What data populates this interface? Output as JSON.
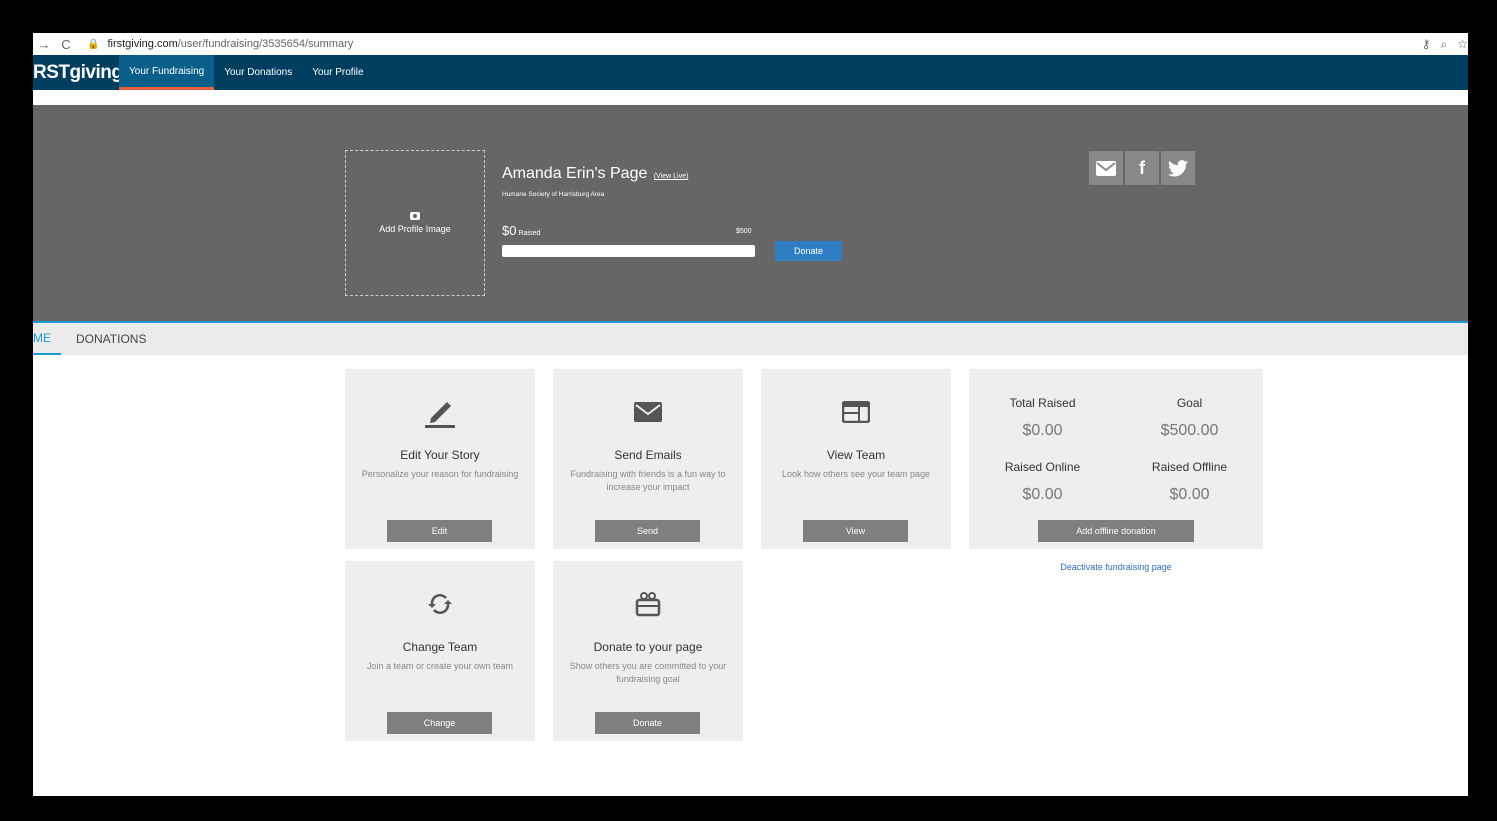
{
  "browser": {
    "url_host": "firstgiving.com",
    "url_path": "/user/fundraising/3535654/summary"
  },
  "nav": {
    "logo": "RSTgiving",
    "items": [
      {
        "label": "Your Fundraising",
        "active": true
      },
      {
        "label": "Your Donations",
        "active": false
      },
      {
        "label": "Your Profile",
        "active": false
      }
    ]
  },
  "hero": {
    "add_profile_image": "Add Profile Image",
    "page_title": "Amanda Erin's Page",
    "view_live": "(View Live)",
    "organization": "Humane Society of Harrisburg Area",
    "raised_amount": "$0",
    "raised_label": "Raised",
    "goal_label": "$500",
    "progress_fraction": 0,
    "donate_label": "Donate"
  },
  "tabs": [
    {
      "label": "ME",
      "active": true
    },
    {
      "label": "DONATIONS",
      "active": false
    }
  ],
  "cards": [
    {
      "title": "Edit Your Story",
      "desc": "Personalize your reason for fundraising",
      "button": "Edit",
      "icon": "pencil-icon"
    },
    {
      "title": "Send Emails",
      "desc": "Fundraising with friends is a fun way to increase your impact",
      "button": "Send",
      "icon": "envelope-icon"
    },
    {
      "title": "View Team",
      "desc": "Look how others see your team page",
      "button": "View",
      "icon": "team-page-icon"
    },
    {
      "title": "Change Team",
      "desc": "Join a team or create your own team",
      "button": "Change",
      "icon": "refresh-icon"
    },
    {
      "title": "Donate to your page",
      "desc": "Show others you are committed to your fundraising goal",
      "button": "Donate",
      "icon": "gift-icon"
    }
  ],
  "stats": {
    "total_raised_label": "Total Raised",
    "total_raised_value": "$0.00",
    "goal_label": "Goal",
    "goal_value": "$500.00",
    "raised_online_label": "Raised Online",
    "raised_online_value": "$0.00",
    "raised_offline_label": "Raised Offline",
    "raised_offline_value": "$0.00",
    "add_offline_button": "Add offline donation",
    "deactivate_link": "Deactivate fundraising page"
  },
  "colors": {
    "nav_bg": "#003e5f",
    "hero_bg": "#666666",
    "accent": "#1e9ad6",
    "donate_button": "#2f7ec4"
  }
}
